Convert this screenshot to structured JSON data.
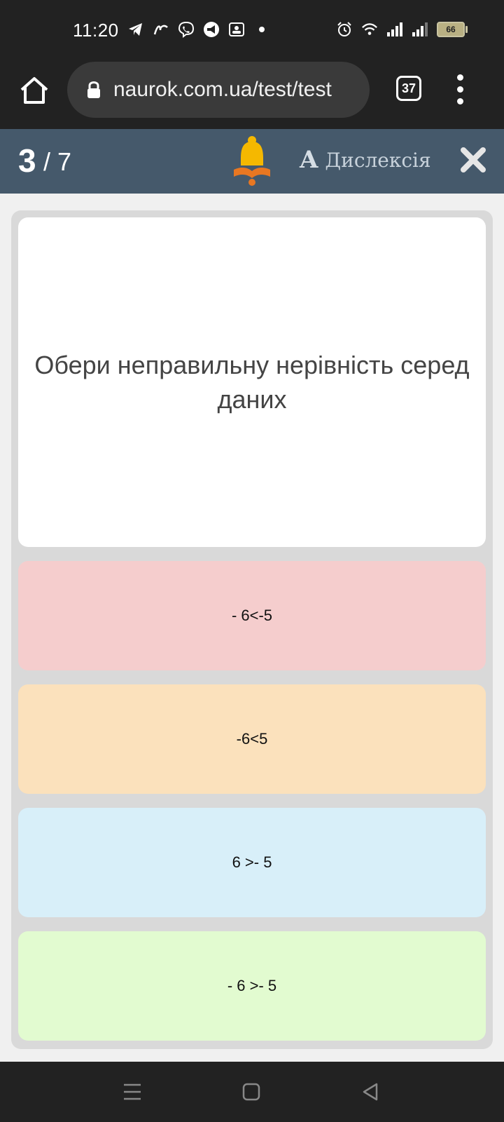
{
  "status_bar": {
    "time": "11:20",
    "left_icons": [
      "telegram-icon",
      "messenger-icon",
      "viber-icon",
      "megaphone-icon",
      "group-chat-icon",
      "dot-icon"
    ],
    "right_icons": [
      "alarm-icon",
      "wifi-icon",
      "signal-icon",
      "signal-icon"
    ],
    "battery_level": "66"
  },
  "browser": {
    "url": "naurok.com.ua/test/test",
    "tab_count": "37"
  },
  "quiz_header": {
    "current": "3",
    "total": "/ 7",
    "dyslexia_glyph": "A",
    "dyslexia_label": "Дислексія"
  },
  "question": {
    "text": "Обери неправильну нерівність серед даних"
  },
  "options": [
    {
      "label": "- 6<-5",
      "color": "#f5cdcd"
    },
    {
      "label": "-6<5",
      "color": "#fbe1bc"
    },
    {
      "label": "6 >- 5",
      "color": "#d8eff9"
    },
    {
      "label": "- 6 >- 5",
      "color": "#e2fbd0"
    }
  ],
  "colors": {
    "header": "#45596b",
    "bell": "#f5b800",
    "system_bar": "#222222"
  }
}
